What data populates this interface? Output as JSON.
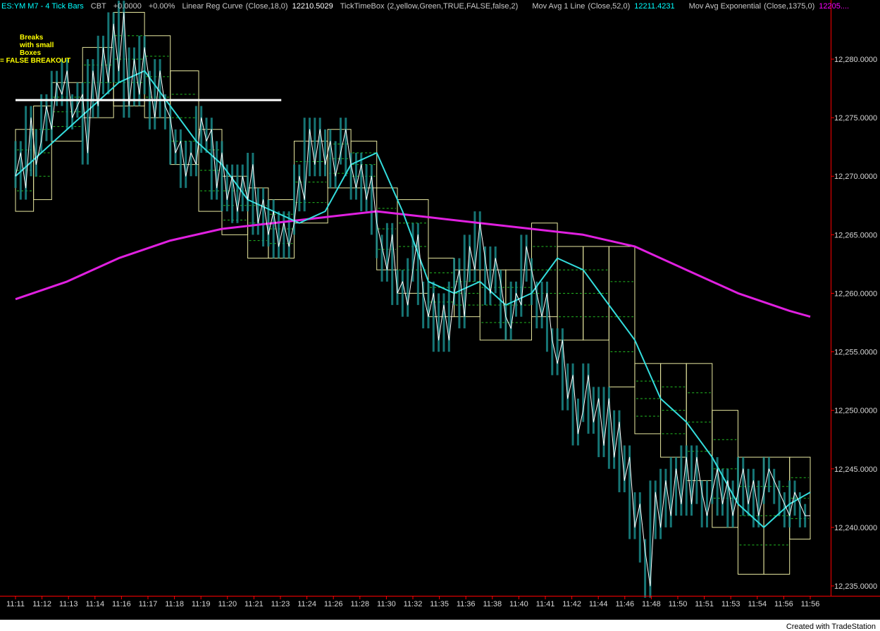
{
  "header": {
    "symbol": "ES:YM M7 - 4 Tick Bars",
    "exchange": "CBT",
    "change": "+0.0000",
    "change_pct": "+0.00%",
    "ind1_name": "Linear Reg Curve",
    "ind1_params": "(Close,18,0)",
    "ind1_value": "12210.5029",
    "ind2_name": "TickTimeBox",
    "ind2_params": "(2,yellow,Green,TRUE,FALSE,false,2)",
    "ind3_name": "Mov Avg 1 Line",
    "ind3_params": "(Close,52,0)",
    "ind3_value": "12211.4231",
    "ind4_name": "Mov Avg Exponential",
    "ind4_params": "(Close,1375,0)",
    "ind4_value": "12205....",
    "colors": {
      "text": "#c8c8c8",
      "cyan": "#00ffff",
      "magenta": "#ff00ff"
    }
  },
  "annotation": {
    "line1": "Breaks",
    "line2": "with small",
    "line3": "Boxes",
    "line4": "= FALSE BREAKOUT"
  },
  "footer": {
    "credit": "Created with TradeStation"
  },
  "chart_data": {
    "type": "line",
    "ylim": [
      12234,
      12285
    ],
    "y_ticks": [
      12235,
      12240,
      12245,
      12250,
      12255,
      12260,
      12265,
      12270,
      12275,
      12280
    ],
    "y_tick_labels": [
      "12,235.0000",
      "12,240.0000",
      "12,245.0000",
      "12,250.0000",
      "12,255.0000",
      "12,260.0000",
      "12,265.0000",
      "12,270.0000",
      "12,275.0000",
      "12,280.0000"
    ],
    "x_tick_labels": [
      "11:11",
      "11:12",
      "11:13",
      "11:14",
      "11:16",
      "11:17",
      "11:18",
      "11:19",
      "11:20",
      "11:21",
      "11:23",
      "11:24",
      "11:26",
      "11:28",
      "11:30",
      "11:32",
      "11:35",
      "11:36",
      "11:38",
      "11:40",
      "11:41",
      "11:42",
      "11:44",
      "11:46",
      "11:48",
      "11:50",
      "11:51",
      "11:53",
      "11:54",
      "11:56",
      "11:56"
    ],
    "x_range": [
      0,
      30.8
    ],
    "colors": {
      "price": "#ffffff",
      "bars": "#1a8a8a",
      "ma52": "#33dddd",
      "ema1375": "#e020e0",
      "box": "#e8e8a0",
      "box_mid": "#22bb22",
      "hline": "#ffffff",
      "axis": "#ff0000",
      "tick_text": "#d8d8d8"
    },
    "price": {
      "x": [
        0,
        0.2,
        0.4,
        0.6,
        0.8,
        1.0,
        1.2,
        1.4,
        1.6,
        1.8,
        2.0,
        2.2,
        2.4,
        2.6,
        2.8,
        3.0,
        3.2,
        3.4,
        3.6,
        3.8,
        4.0,
        4.2,
        4.4,
        4.6,
        4.8,
        5.0,
        5.2,
        5.4,
        5.6,
        5.8,
        6.0,
        6.2,
        6.4,
        6.6,
        6.8,
        7.0,
        7.2,
        7.4,
        7.6,
        7.8,
        8.0,
        8.2,
        8.4,
        8.6,
        8.8,
        9.0,
        9.2,
        9.4,
        9.6,
        9.8,
        10.0,
        10.2,
        10.4,
        10.6,
        10.8,
        11.0,
        11.2,
        11.4,
        11.6,
        11.8,
        12.0,
        12.2,
        12.4,
        12.6,
        12.8,
        13.0,
        13.2,
        13.4,
        13.6,
        13.8,
        14.0,
        14.2,
        14.4,
        14.6,
        14.8,
        15.0,
        15.2,
        15.4,
        15.6,
        15.8,
        16.0,
        16.2,
        16.4,
        16.6,
        16.8,
        17.0,
        17.2,
        17.4,
        17.6,
        17.8,
        18.0,
        18.2,
        18.4,
        18.6,
        18.8,
        19.0,
        19.2,
        19.4,
        19.6,
        19.8,
        20.0,
        20.2,
        20.4,
        20.6,
        20.8,
        21.0,
        21.2,
        21.4,
        21.6,
        21.8,
        22.0,
        22.2,
        22.4,
        22.6,
        22.8,
        23.0,
        23.2,
        23.4,
        23.6,
        23.8,
        24.0,
        24.2,
        24.4,
        24.6,
        24.8,
        25.0,
        25.2,
        25.4,
        25.6,
        25.8,
        26.0,
        26.2,
        26.4,
        26.6,
        26.8,
        27.0,
        27.2,
        27.4,
        27.6,
        27.8,
        28.0,
        28.2,
        28.4,
        28.6,
        28.8,
        29.0,
        29.2,
        29.4,
        29.6,
        29.8,
        30.0,
        30.2,
        30.4,
        30.6,
        30.8
      ],
      "y": [
        12270,
        12272,
        12269,
        12275,
        12271,
        12273,
        12276,
        12274,
        12278,
        12277,
        12279,
        12275,
        12276,
        12277,
        12272,
        12279,
        12276,
        12281,
        12278,
        12283,
        12279,
        12284,
        12276,
        12280,
        12277,
        12281,
        12278,
        12275,
        12279,
        12276,
        12275,
        12272,
        12273,
        12270,
        12272,
        12271,
        12275,
        12273,
        12274,
        12269,
        12272,
        12268,
        12270,
        12267,
        12270,
        12268,
        12271,
        12266,
        12268,
        12265,
        12267,
        12264,
        12266,
        12264,
        12266,
        12270,
        12268,
        12274,
        12271,
        12274,
        12271,
        12273,
        12270,
        12272,
        12274,
        12271,
        12269,
        12271,
        12268,
        12270,
        12266,
        12264,
        12262,
        12265,
        12260,
        12261,
        12259,
        12262,
        12265,
        12260,
        12258,
        12260,
        12256,
        12259,
        12256,
        12260,
        12262,
        12258,
        12264,
        12262,
        12266,
        12263,
        12260,
        12263,
        12261,
        12258,
        12257,
        12260,
        12259,
        12264,
        12262,
        12260,
        12258,
        12260,
        12256,
        12254,
        12256,
        12251,
        12253,
        12248,
        12250,
        12253,
        12249,
        12251,
        12247,
        12251,
        12246,
        12249,
        12244,
        12246,
        12240,
        12242,
        12238,
        12235,
        12243,
        12240,
        12244,
        12241,
        12245,
        12242,
        12246,
        12242,
        12246,
        12243,
        12241,
        12243,
        12245,
        12242,
        12244,
        12241,
        12243,
        12245,
        12242,
        12244,
        12241,
        12243,
        12245,
        12244,
        12243,
        12242,
        12241,
        12243,
        12242,
        12241,
        12241
      ],
      "_note": "shown as trace"
    },
    "ma52": {
      "x": [
        0,
        1,
        2,
        3,
        4,
        5,
        6,
        7,
        8,
        9,
        10,
        11,
        12,
        13,
        14,
        15,
        16,
        17,
        18,
        19,
        20,
        21,
        22,
        23,
        24,
        25,
        26,
        27,
        28,
        29,
        30,
        30.8
      ],
      "y": [
        12270,
        12272,
        12274,
        12276,
        12278,
        12279,
        12276,
        12273,
        12271,
        12268,
        12267,
        12266,
        12267,
        12271,
        12272,
        12267,
        12261,
        12260,
        12261,
        12259,
        12260,
        12263,
        12262,
        12259,
        12256,
        12251,
        12249,
        12246,
        12242,
        12240,
        12242,
        12243
      ]
    },
    "ema1375": {
      "x": [
        0,
        2,
        4,
        6,
        8,
        10,
        12,
        14,
        16,
        18,
        20,
        22,
        24,
        26,
        28,
        30,
        30.8
      ],
      "y": [
        12259.5,
        12261,
        12263,
        12264.5,
        12265.5,
        12266,
        12266.5,
        12267,
        12266.5,
        12266,
        12265.5,
        12265,
        12264,
        12262,
        12260,
        12258.5,
        12258
      ]
    },
    "boxes": [
      {
        "x0": 0.0,
        "x1": 0.7,
        "y0": 12267,
        "y1": 12274
      },
      {
        "x0": 0.7,
        "x1": 1.4,
        "y0": 12268,
        "y1": 12276
      },
      {
        "x0": 1.4,
        "x1": 2.6,
        "y0": 12273,
        "y1": 12278
      },
      {
        "x0": 2.6,
        "x1": 3.8,
        "y0": 12275,
        "y1": 12281
      },
      {
        "x0": 3.8,
        "x1": 5.0,
        "y0": 12276,
        "y1": 12284
      },
      {
        "x0": 5.0,
        "x1": 6.0,
        "y0": 12275,
        "y1": 12282
      },
      {
        "x0": 6.0,
        "x1": 7.1,
        "y0": 12271,
        "y1": 12279
      },
      {
        "x0": 7.1,
        "x1": 8.0,
        "y0": 12267,
        "y1": 12274
      },
      {
        "x0": 8.0,
        "x1": 9.0,
        "y0": 12265,
        "y1": 12270
      },
      {
        "x0": 9.0,
        "x1": 9.8,
        "y0": 12263,
        "y1": 12269
      },
      {
        "x0": 9.8,
        "x1": 10.8,
        "y0": 12263,
        "y1": 12268
      },
      {
        "x0": 10.8,
        "x1": 12.1,
        "y0": 12266,
        "y1": 12273
      },
      {
        "x0": 12.1,
        "x1": 13.0,
        "y0": 12269,
        "y1": 12274
      },
      {
        "x0": 13.0,
        "x1": 14.0,
        "y0": 12269,
        "y1": 12273
      },
      {
        "x0": 14.0,
        "x1": 14.8,
        "y0": 12262,
        "y1": 12269
      },
      {
        "x0": 14.8,
        "x1": 16.0,
        "y0": 12260,
        "y1": 12268
      },
      {
        "x0": 16.0,
        "x1": 17.0,
        "y0": 12258,
        "y1": 12263
      },
      {
        "x0": 17.0,
        "x1": 18.0,
        "y0": 12258,
        "y1": 12262
      },
      {
        "x0": 18.0,
        "x1": 19.0,
        "y0": 12256,
        "y1": 12262
      },
      {
        "x0": 19.0,
        "x1": 20.0,
        "y0": 12256,
        "y1": 12262
      },
      {
        "x0": 20.0,
        "x1": 21.0,
        "y0": 12258,
        "y1": 12266
      },
      {
        "x0": 21.0,
        "x1": 22.0,
        "y0": 12256,
        "y1": 12264
      },
      {
        "x0": 22.0,
        "x1": 23.0,
        "y0": 12256,
        "y1": 12264
      },
      {
        "x0": 23.0,
        "x1": 24.0,
        "y0": 12252,
        "y1": 12264
      },
      {
        "x0": 24.0,
        "x1": 25.0,
        "y0": 12248,
        "y1": 12254
      },
      {
        "x0": 25.0,
        "x1": 26.0,
        "y0": 12246,
        "y1": 12254
      },
      {
        "x0": 26.0,
        "x1": 27.0,
        "y0": 12244,
        "y1": 12254
      },
      {
        "x0": 27.0,
        "x1": 28.0,
        "y0": 12240,
        "y1": 12250
      },
      {
        "x0": 28.0,
        "x1": 29.0,
        "y0": 12236,
        "y1": 12246
      },
      {
        "x0": 29.0,
        "x1": 30.0,
        "y0": 12236,
        "y1": 12246
      },
      {
        "x0": 30.0,
        "x1": 30.8,
        "y0": 12239,
        "y1": 12246
      }
    ],
    "hline": {
      "x0": 0,
      "x1": 10.3,
      "y": 12276.5
    }
  }
}
